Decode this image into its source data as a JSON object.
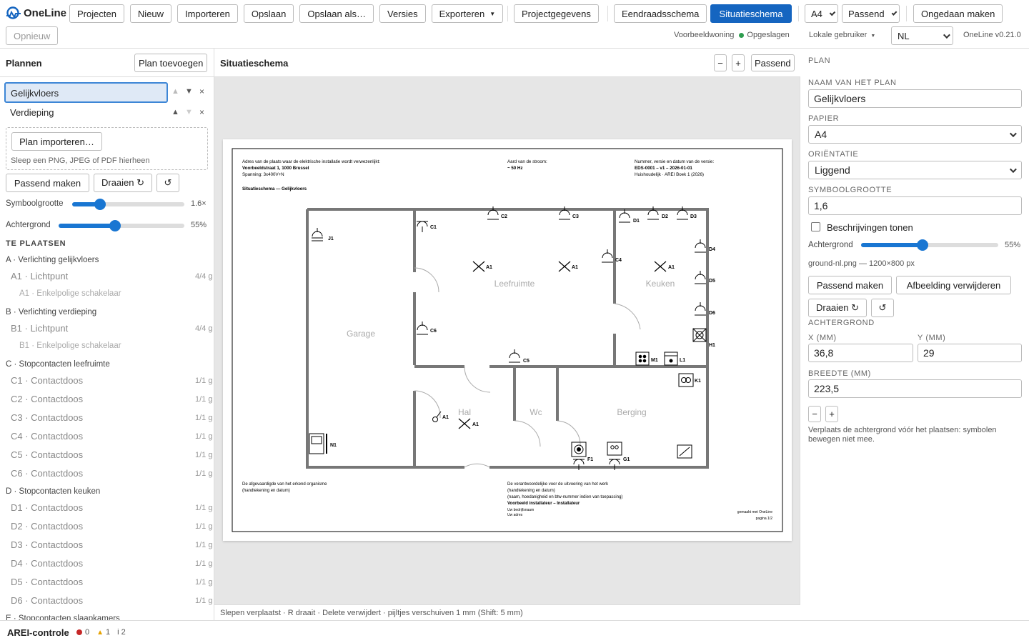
{
  "app": {
    "logo": "OneLine",
    "version": "OneLine v0.21.0"
  },
  "toolbar": {
    "projects": "Projecten",
    "new": "Nieuw",
    "import": "Importeren",
    "save": "Opslaan",
    "save_as": "Opslaan als…",
    "versions": "Versies",
    "export": "Exporteren",
    "project_data": "Projectgegevens",
    "single_line": "Eendraadsschema",
    "situation": "Situatieschema",
    "paper": "A4",
    "fit": "Passend",
    "undo": "Ongedaan maken",
    "redo": "Opnieuw"
  },
  "status": {
    "project": "Voorbeeldwoning",
    "saved": "Opgeslagen",
    "user": "Lokale gebruiker",
    "language": "NL",
    "saved_color": "#2e9d4f"
  },
  "left": {
    "title": "Plannen",
    "add_plan": "Plan toevoegen",
    "plans": [
      {
        "name": "Gelijkvloers",
        "active": true
      },
      {
        "name": "Verdieping",
        "active": false
      }
    ],
    "import_button": "Plan importeren…",
    "drop_hint": "Sleep een PNG, JPEG of PDF hierheen",
    "fit": "Passend maken",
    "rotate": "Draaien ↻",
    "rotate_back": "↺",
    "symbol_size_label": "Symboolgrootte",
    "symbol_size_value": "1.6×",
    "symbol_size_fraction": 0.25,
    "background_label": "Achtergrond",
    "background_value": "55%",
    "background_fraction": 0.45,
    "to_place_title": "TE PLAATSEN",
    "groups": [
      {
        "title": "A · Verlichting gelijkvloers",
        "items": [
          {
            "label": "A1 · Lichtpunt",
            "count": "4/4 g"
          },
          {
            "label": "A1 · Enkelpolige schakelaar",
            "count": "",
            "sub": true
          }
        ]
      },
      {
        "title": "B · Verlichting verdieping",
        "items": [
          {
            "label": "B1 · Lichtpunt",
            "count": "4/4 g"
          },
          {
            "label": "B1 · Enkelpolige schakelaar",
            "count": "",
            "sub": true
          }
        ]
      },
      {
        "title": "C · Stopcontacten leefruimte",
        "items": [
          {
            "label": "C1 · Contactdoos",
            "count": "1/1 g"
          },
          {
            "label": "C2 · Contactdoos",
            "count": "1/1 g"
          },
          {
            "label": "C3 · Contactdoos",
            "count": "1/1 g"
          },
          {
            "label": "C4 · Contactdoos",
            "count": "1/1 g"
          },
          {
            "label": "C5 · Contactdoos",
            "count": "1/1 g"
          },
          {
            "label": "C6 · Contactdoos",
            "count": "1/1 g"
          }
        ]
      },
      {
        "title": "D · Stopcontacten keuken",
        "items": [
          {
            "label": "D1 · Contactdoos",
            "count": "1/1 g"
          },
          {
            "label": "D2 · Contactdoos",
            "count": "1/1 g"
          },
          {
            "label": "D3 · Contactdoos",
            "count": "1/1 g"
          },
          {
            "label": "D4 · Contactdoos",
            "count": "1/1 g"
          },
          {
            "label": "D5 · Contactdoos",
            "count": "1/1 g"
          },
          {
            "label": "D6 · Contactdoos",
            "count": "1/1 g"
          }
        ]
      },
      {
        "title": "E · Stopcontacten slaapkamers",
        "items": []
      }
    ]
  },
  "center": {
    "title": "Situatieschema",
    "zoom_out": "−",
    "zoom_in": "+",
    "fit": "Passend",
    "hint": "Slepen verplaatst · R draait · Delete verwijdert · pijltjes verschuiven 1 mm (Shift: 5 mm)"
  },
  "sheet": {
    "address_label": "Adres van de plaats waar de elektrische installatie wordt verwezenlijkt:",
    "address": "Voorbeeldstraat 1, 1000 Brussel",
    "voltage": "Spanning:  3x400V+N",
    "current_label": "Aard van de stroom:",
    "current": "~ 50 Hz",
    "doc_label": "Nummer, versie en datum van de versie:",
    "doc_id": "EDS-0001 – v1 – 2026-01-01",
    "doc_sub": "Huishoudelijk · AREI Boek 1 (2026)",
    "sheet_title": "Situatieschema — Gelijkvloers",
    "rooms": {
      "garage": "Garage",
      "living": "Leefruimte",
      "kitchen": "Keuken",
      "hall": "Hal",
      "wc": "Wc",
      "storage": "Berging"
    },
    "labels": {
      "J1": "J1",
      "C1": "C1",
      "C2": "C2",
      "C3": "C3",
      "C4": "C4",
      "C5": "C5",
      "C6": "C6",
      "D1": "D1",
      "D2": "D2",
      "D3": "D3",
      "D4": "D4",
      "D5": "D5",
      "D6": "D6",
      "A1": "A1",
      "H1": "H1",
      "M1": "M1",
      "L1": "L1",
      "K1": "K1",
      "F1": "F1",
      "G1": "G1",
      "N1": "N1"
    },
    "footer_left_1": "De afgevaardigde van het erkend organisme",
    "footer_left_2": "(handtekening en datum)",
    "footer_mid_1": "De verantwoordelijke voor de uitvoering van het werk",
    "footer_mid_2": "(handtekening en datum)",
    "footer_mid_3": "(naam, hoedanigheid en btw-nummer indien van toepassing)",
    "footer_mid_4": "Voorbeeld installateur – Installateur",
    "footer_mid_5": "Uw bedrijfsnaam",
    "footer_mid_6": "Uw adres",
    "made_with": "gemaakt met OneLine",
    "page": "pagina 1/2"
  },
  "right": {
    "section": "PLAN",
    "name_label": "NAAM VAN HET PLAN",
    "name_value": "Gelijkvloers",
    "paper_label": "PAPIER",
    "paper_value": "A4",
    "orientation_label": "ORIËNTATIE",
    "orientation_value": "Liggend",
    "symbol_label": "SYMBOOLGROOTTE",
    "symbol_value": "1,6",
    "descriptions": "Beschrijvingen tonen",
    "background_label": "Achtergrond",
    "background_value": "55%",
    "background_fraction": 0.45,
    "file_info": "ground-nl.png — 1200×800 px",
    "fit": "Passend maken",
    "remove_image": "Afbeelding verwijderen",
    "rotate": "Draaien ↻",
    "rotate_back": "↺",
    "bg_section": "ACHTERGROND",
    "x_label": "X (MM)",
    "x_value": "36,8",
    "y_label": "Y (MM)",
    "y_value": "29",
    "width_label": "BREEDTE (MM)",
    "width_value": "223,5",
    "minus": "−",
    "plus": "+",
    "note": "Verplaats de achtergrond vóór het plaatsen: symbolen bewegen niet mee."
  },
  "bottom": {
    "title": "AREI-controle",
    "errors": "0",
    "warnings": "1",
    "info": "i 2"
  }
}
